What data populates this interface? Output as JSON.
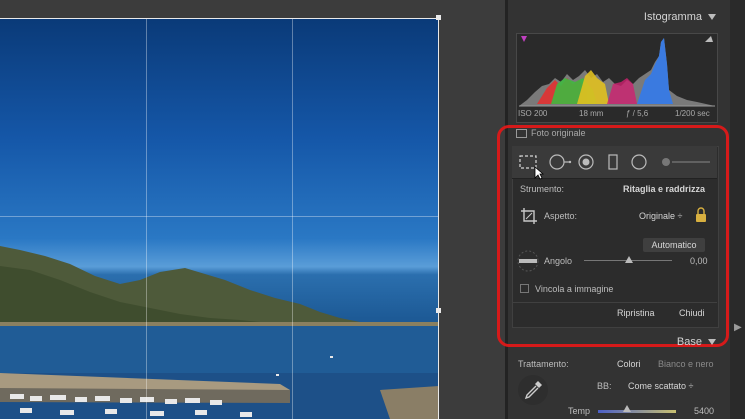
{
  "histogram": {
    "title": "Istogramma",
    "iso": "ISO 200",
    "focal": "18 mm",
    "aperture": "ƒ / 5,6",
    "shutter": "1/200 sec",
    "original_photo_label": "Foto originale"
  },
  "tools": {
    "tool_label": "Strumento:",
    "tool_value": "Ritaglia e raddrizza",
    "aspect_label": "Aspetto:",
    "aspect_value": "Originale ÷",
    "auto_label": "Automatico",
    "angle_label": "Angolo",
    "angle_value": "0,00",
    "constrain_label": "Vincola a immagine",
    "reset_label": "Ripristina",
    "close_label": "Chiudi"
  },
  "base": {
    "title": "Base",
    "treatment_label": "Trattamento:",
    "color_label": "Colori",
    "bw_label": "Bianco e nero",
    "wb_label": "BB:",
    "wb_value": "Come scattato ÷",
    "temp_label": "Temp",
    "temp_value": "5400"
  },
  "colors": {
    "highlight": "#d61a1a",
    "panel_bg": "#333333"
  }
}
